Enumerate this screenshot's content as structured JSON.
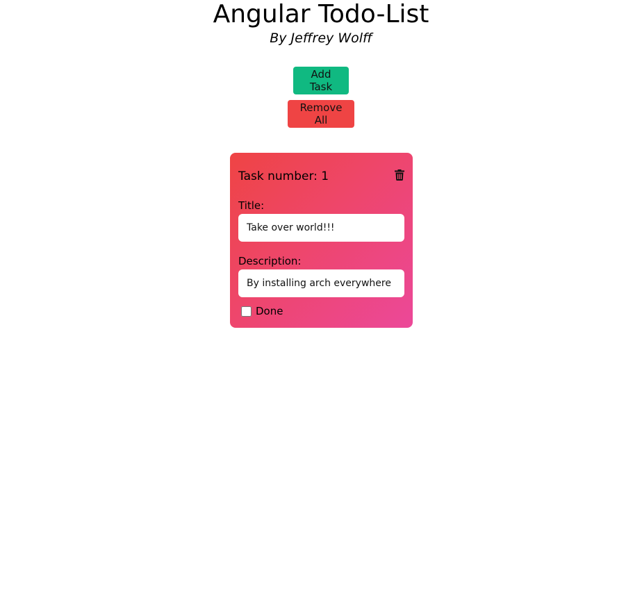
{
  "header": {
    "title": "Angular Todo-List",
    "subtitle": "By Jeffrey Wolff"
  },
  "actions": {
    "add_label": "Add Task",
    "remove_all_label": "Remove All",
    "add_color": "#10b981",
    "remove_color": "#ef4444"
  },
  "tasks": [
    {
      "number_label": "Task number: 1",
      "delete_icon": "trash-icon",
      "title_label": "Title:",
      "title_value": "Take over world!!!",
      "description_label": "Description:",
      "description_value": "By installing arch everywhere",
      "done_label": "Done",
      "done": false,
      "gradient": [
        "#ef4444",
        "#ec4899"
      ]
    }
  ]
}
